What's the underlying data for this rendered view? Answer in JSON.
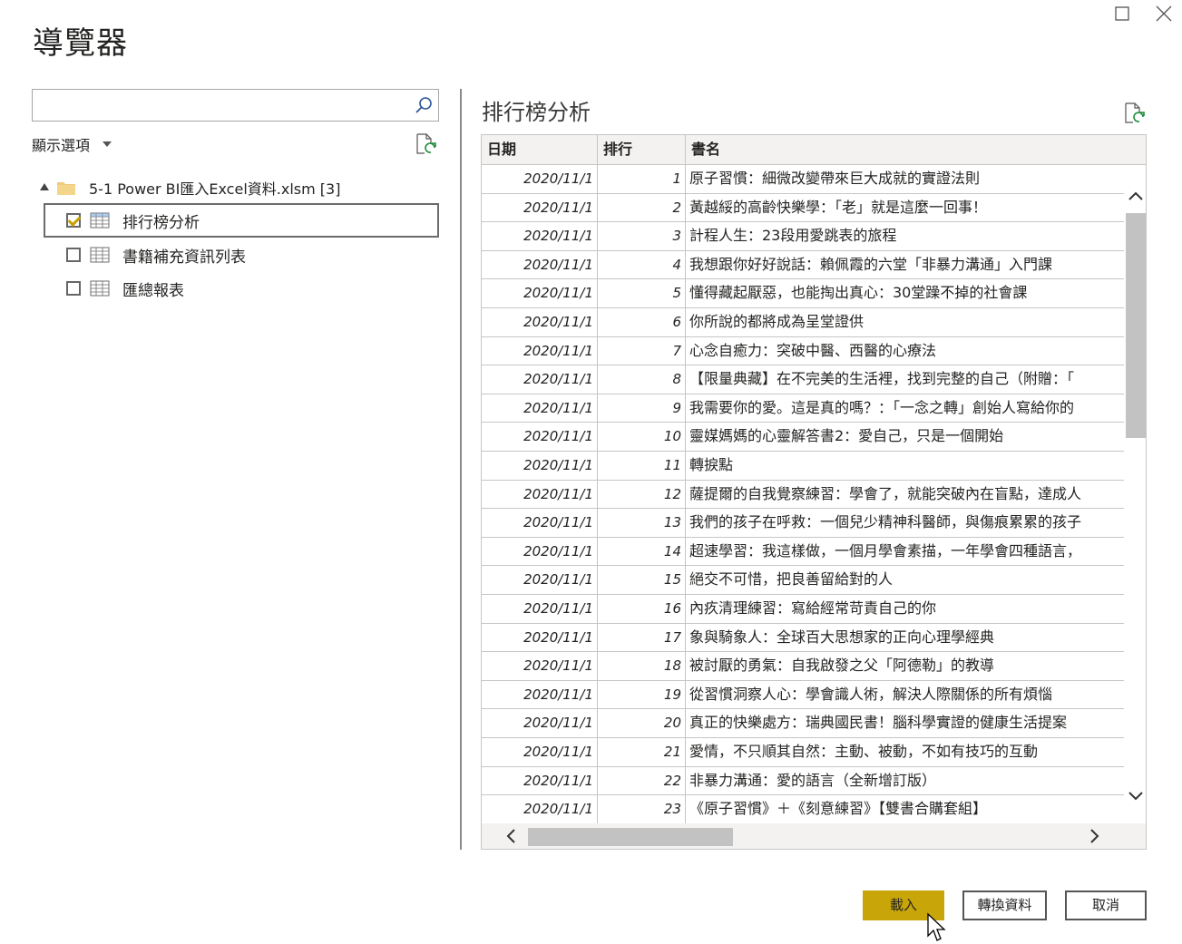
{
  "window": {
    "title": "導覽器"
  },
  "search": {
    "value": "",
    "placeholder": ""
  },
  "navigator": {
    "display_options_label": "顯示選項",
    "root": {
      "label": "5-1 Power BI匯入Excel資料.xlsm [3]"
    },
    "items": [
      {
        "label": "排行榜分析",
        "checked": true,
        "selected": true
      },
      {
        "label": "書籍補充資訊列表",
        "checked": false,
        "selected": false
      },
      {
        "label": "匯總報表",
        "checked": false,
        "selected": false
      }
    ]
  },
  "preview": {
    "title": "排行榜分析",
    "columns": [
      "日期",
      "排行",
      "書名"
    ],
    "rows": [
      [
        "2020/11/1",
        "1",
        "原子習慣：細微改變帶來巨大成就的實證法則"
      ],
      [
        "2020/11/1",
        "2",
        "黃越綏的高齡快樂學：「老」就是這麼一回事！"
      ],
      [
        "2020/11/1",
        "3",
        "計程人生：23段用愛跳表的旅程"
      ],
      [
        "2020/11/1",
        "4",
        "我想跟你好好說話：賴佩霞的六堂「非暴力溝通」入門課"
      ],
      [
        "2020/11/1",
        "5",
        "懂得藏起厭惡，也能掏出真心：30堂躁不掉的社會課"
      ],
      [
        "2020/11/1",
        "6",
        "你所說的都將成為呈堂證供"
      ],
      [
        "2020/11/1",
        "7",
        "心念自癒力：突破中醫、西醫的心療法"
      ],
      [
        "2020/11/1",
        "8",
        "【限量典藏】在不完美的生活裡，找到完整的自己（附贈：「"
      ],
      [
        "2020/11/1",
        "9",
        "我需要你的愛。這是真的嗎？：「一念之轉」創始人寫給你的"
      ],
      [
        "2020/11/1",
        "10",
        "靈媒媽媽的心靈解答書2：愛自己，只是一個開始"
      ],
      [
        "2020/11/1",
        "11",
        "轉捩點"
      ],
      [
        "2020/11/1",
        "12",
        "薩提爾的自我覺察練習：學會了，就能突破內在盲點，達成人"
      ],
      [
        "2020/11/1",
        "13",
        "我們的孩子在呼救：一個兒少精神科醫師，與傷痕累累的孩子"
      ],
      [
        "2020/11/1",
        "14",
        "超速學習：我這樣做，一個月學會素描，一年學會四種語言，"
      ],
      [
        "2020/11/1",
        "15",
        "絕交不可惜，把良善留給對的人"
      ],
      [
        "2020/11/1",
        "16",
        "內疚清理練習：寫給經常苛責自己的你"
      ],
      [
        "2020/11/1",
        "17",
        "象與騎象人：全球百大思想家的正向心理學經典"
      ],
      [
        "2020/11/1",
        "18",
        "被討厭的勇氣：自我啟發之父「阿德勒」的教導"
      ],
      [
        "2020/11/1",
        "19",
        "從習慣洞察人心：學會識人術，解決人際關係的所有煩惱"
      ],
      [
        "2020/11/1",
        "20",
        "真正的快樂處方：瑞典國民書！腦科學實證的健康生活提案"
      ],
      [
        "2020/11/1",
        "21",
        "愛情，不只順其自然：主動、被動，不如有技巧的互動"
      ],
      [
        "2020/11/1",
        "22",
        "非暴力溝通：愛的語言（全新增訂版）"
      ],
      [
        "2020/11/1",
        "23",
        "《原子習慣》＋《刻意練習》【雙書合購套組】"
      ]
    ]
  },
  "buttons": {
    "load": "載入",
    "transform": "轉換資料",
    "cancel": "取消"
  },
  "colors": {
    "accent": "#c8a508",
    "checkmark": "#c8a000"
  }
}
